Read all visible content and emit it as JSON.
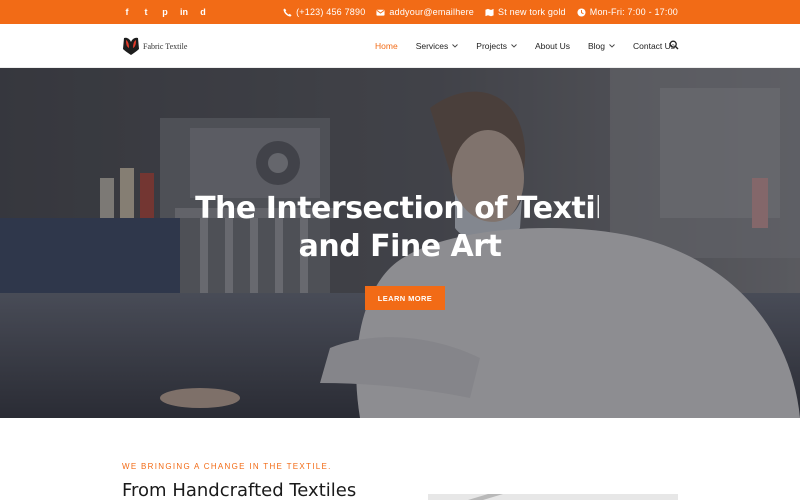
{
  "topbar": {
    "social": [
      "f",
      "t",
      "p",
      "in",
      "d"
    ],
    "phone": "(+123) 456 7890",
    "email": "addyour@emailhere",
    "address": "St new tork gold",
    "hours": "Mon-Fri: 7:00 - 17:00"
  },
  "brand": {
    "name": "Fabric Textile"
  },
  "nav": {
    "items": [
      {
        "label": "Home"
      },
      {
        "label": "Services"
      },
      {
        "label": "Projects"
      },
      {
        "label": "About Us"
      },
      {
        "label": "Blog"
      },
      {
        "label": "Contact Us"
      }
    ]
  },
  "hero": {
    "line1": "The Intersection of Textil",
    "line2": "and Fine Art",
    "button": "LEARN MORE"
  },
  "intro": {
    "tagline": "WE BRINGING A CHANGE IN THE TEXTILE.",
    "title": "From Handcrafted Textiles"
  },
  "colors": {
    "accent": "#f26b16",
    "hero_overlay": "#2e3035"
  },
  "icons": [
    "facebook-icon",
    "twitter-icon",
    "pinterest-icon",
    "linkedin-icon",
    "dribbble-icon",
    "phone-icon",
    "email-icon",
    "map-icon",
    "clock-icon",
    "search-icon",
    "chevron-down-icon"
  ]
}
